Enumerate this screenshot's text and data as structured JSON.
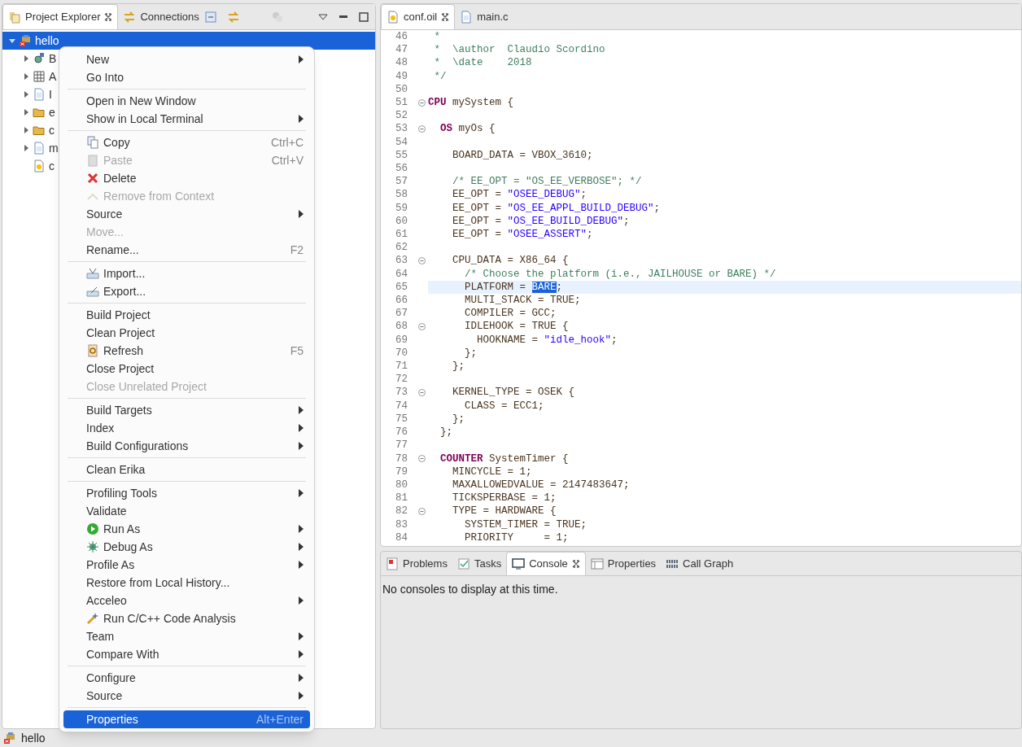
{
  "project_explorer": {
    "tabs": [
      {
        "label": "Project Explorer",
        "selected": true,
        "closable": true
      },
      {
        "label": "Connections",
        "selected": false,
        "closable": false
      }
    ],
    "tree": [
      {
        "label": "hello",
        "kind": "branch",
        "expanded": true,
        "selected": true,
        "children": [
          {
            "label": "B",
            "kind": "branch",
            "expanded": false,
            "selected": false
          },
          {
            "label": "A",
            "kind": "branch",
            "expanded": false,
            "selected": false
          },
          {
            "label": "I",
            "kind": "branch",
            "expanded": false,
            "selected": false
          },
          {
            "label": "e",
            "kind": "branch",
            "expanded": false,
            "selected": false
          },
          {
            "label": "c",
            "kind": "branch",
            "expanded": false,
            "selected": false
          },
          {
            "label": "m",
            "kind": "branch",
            "expanded": false,
            "selected": false
          },
          {
            "label": "c",
            "kind": "leaf",
            "selected": false
          }
        ]
      }
    ]
  },
  "editor": {
    "tabs": [
      {
        "label": "conf.oil",
        "selected": true,
        "closable": true
      },
      {
        "label": "main.c",
        "selected": false,
        "closable": false
      }
    ],
    "lines": [
      {
        "n": "46",
        "fold": false,
        "current": false,
        "tokens": [
          {
            "kind": "cm",
            "t": " *"
          }
        ]
      },
      {
        "n": "47",
        "fold": false,
        "current": false,
        "tokens": [
          {
            "kind": "cm",
            "t": " *  \\author  Claudio Scordino"
          }
        ]
      },
      {
        "n": "48",
        "fold": false,
        "current": false,
        "tokens": [
          {
            "kind": "cm",
            "t": " *  \\date    2018"
          }
        ]
      },
      {
        "n": "49",
        "fold": false,
        "current": false,
        "tokens": [
          {
            "kind": "cm",
            "t": " */"
          }
        ]
      },
      {
        "n": "50",
        "fold": false,
        "current": false
      },
      {
        "n": "51",
        "fold": true,
        "current": false,
        "tokens": [
          {
            "kind": "kw",
            "t": "CPU"
          },
          {
            "kind": "tx",
            "t": " mySystem {"
          }
        ]
      },
      {
        "n": "52",
        "fold": false,
        "current": false
      },
      {
        "n": "53",
        "fold": true,
        "current": false,
        "tokens": [
          {
            "kind": "kw",
            "t": "  OS"
          },
          {
            "kind": "tx",
            "t": " myOs {"
          }
        ]
      },
      {
        "n": "54",
        "fold": false,
        "current": false
      },
      {
        "n": "55",
        "fold": false,
        "current": false,
        "tokens": [
          {
            "kind": "tx",
            "t": "    BOARD_DATA = VBOX_3610;"
          }
        ]
      },
      {
        "n": "56",
        "fold": false,
        "current": false
      },
      {
        "n": "57",
        "fold": false,
        "current": false,
        "tokens": [
          {
            "kind": "cm",
            "t": "    /* EE_OPT = \"OS_EE_VERBOSE\"; */"
          }
        ]
      },
      {
        "n": "58",
        "fold": false,
        "current": false,
        "tokens": [
          {
            "kind": "tx",
            "t": "    EE_OPT = "
          },
          {
            "kind": "str",
            "t": "\"OSEE_DEBUG\""
          },
          {
            "kind": "tx",
            "t": ";"
          }
        ]
      },
      {
        "n": "59",
        "fold": false,
        "current": false,
        "tokens": [
          {
            "kind": "tx",
            "t": "    EE_OPT = "
          },
          {
            "kind": "str",
            "t": "\"OS_EE_APPL_BUILD_DEBUG\""
          },
          {
            "kind": "tx",
            "t": ";"
          }
        ]
      },
      {
        "n": "60",
        "fold": false,
        "current": false,
        "tokens": [
          {
            "kind": "tx",
            "t": "    EE_OPT = "
          },
          {
            "kind": "str",
            "t": "\"OS_EE_BUILD_DEBUG\""
          },
          {
            "kind": "tx",
            "t": ";"
          }
        ]
      },
      {
        "n": "61",
        "fold": false,
        "current": false,
        "tokens": [
          {
            "kind": "tx",
            "t": "    EE_OPT = "
          },
          {
            "kind": "str",
            "t": "\"OSEE_ASSERT\""
          },
          {
            "kind": "tx",
            "t": ";"
          }
        ]
      },
      {
        "n": "62",
        "fold": false,
        "current": false
      },
      {
        "n": "63",
        "fold": true,
        "current": false,
        "tokens": [
          {
            "kind": "tx",
            "t": "    CPU_DATA = X86_64 {"
          }
        ]
      },
      {
        "n": "64",
        "fold": false,
        "current": false,
        "tokens": [
          {
            "kind": "cm",
            "t": "      /* Choose the platform (i.e., JAILHOUSE or BARE) */"
          }
        ]
      },
      {
        "n": "65",
        "fold": false,
        "current": true,
        "tokens": [
          {
            "kind": "tx",
            "t": "      PLATFORM = "
          },
          {
            "kind": "sel",
            "t": "BARE"
          },
          {
            "kind": "tx",
            "t": ";"
          }
        ]
      },
      {
        "n": "66",
        "fold": false,
        "current": false,
        "tokens": [
          {
            "kind": "tx",
            "t": "      MULTI_STACK = TRUE;"
          }
        ]
      },
      {
        "n": "67",
        "fold": false,
        "current": false,
        "tokens": [
          {
            "kind": "tx",
            "t": "      COMPILER = GCC;"
          }
        ]
      },
      {
        "n": "68",
        "fold": true,
        "current": false,
        "tokens": [
          {
            "kind": "tx",
            "t": "      IDLEHOOK = TRUE {"
          }
        ]
      },
      {
        "n": "69",
        "fold": false,
        "current": false,
        "tokens": [
          {
            "kind": "tx",
            "t": "        HOOKNAME = "
          },
          {
            "kind": "str",
            "t": "\"idle_hook\""
          },
          {
            "kind": "tx",
            "t": ";"
          }
        ]
      },
      {
        "n": "70",
        "fold": false,
        "current": false,
        "tokens": [
          {
            "kind": "tx",
            "t": "      };"
          }
        ]
      },
      {
        "n": "71",
        "fold": false,
        "current": false,
        "tokens": [
          {
            "kind": "tx",
            "t": "    };"
          }
        ]
      },
      {
        "n": "72",
        "fold": false,
        "current": false
      },
      {
        "n": "73",
        "fold": true,
        "current": false,
        "tokens": [
          {
            "kind": "tx",
            "t": "    KERNEL_TYPE = OSEK {"
          }
        ]
      },
      {
        "n": "74",
        "fold": false,
        "current": false,
        "tokens": [
          {
            "kind": "tx",
            "t": "      CLASS = ECC1;"
          }
        ]
      },
      {
        "n": "75",
        "fold": false,
        "current": false,
        "tokens": [
          {
            "kind": "tx",
            "t": "    };"
          }
        ]
      },
      {
        "n": "76",
        "fold": false,
        "current": false,
        "tokens": [
          {
            "kind": "tx",
            "t": "  };"
          }
        ]
      },
      {
        "n": "77",
        "fold": false,
        "current": false
      },
      {
        "n": "78",
        "fold": true,
        "current": false,
        "tokens": [
          {
            "kind": "kw",
            "t": "  COUNTER"
          },
          {
            "kind": "tx",
            "t": " SystemTimer {"
          }
        ]
      },
      {
        "n": "79",
        "fold": false,
        "current": false,
        "tokens": [
          {
            "kind": "tx",
            "t": "    MINCYCLE = 1;"
          }
        ]
      },
      {
        "n": "80",
        "fold": false,
        "current": false,
        "tokens": [
          {
            "kind": "tx",
            "t": "    MAXALLOWEDVALUE = 2147483647;"
          }
        ]
      },
      {
        "n": "81",
        "fold": false,
        "current": false,
        "tokens": [
          {
            "kind": "tx",
            "t": "    TICKSPERBASE = 1;"
          }
        ]
      },
      {
        "n": "82",
        "fold": true,
        "current": false,
        "tokens": [
          {
            "kind": "tx",
            "t": "    TYPE = HARDWARE {"
          }
        ]
      },
      {
        "n": "83",
        "fold": false,
        "current": false,
        "tokens": [
          {
            "kind": "tx",
            "t": "      SYSTEM_TIMER = TRUE;"
          }
        ]
      },
      {
        "n": "84",
        "fold": false,
        "current": false,
        "tokens": [
          {
            "kind": "tx",
            "t": "      PRIORITY     = 1;"
          }
        ]
      }
    ]
  },
  "bottom_panel": {
    "tabs": [
      {
        "label": "Problems",
        "selected": false,
        "closable": false
      },
      {
        "label": "Tasks",
        "selected": false,
        "closable": false
      },
      {
        "label": "Console",
        "selected": true,
        "closable": true
      },
      {
        "label": "Properties",
        "selected": false,
        "closable": false
      },
      {
        "label": "Call Graph",
        "selected": false,
        "closable": false
      }
    ],
    "message": "No consoles to display at this time."
  },
  "context_menu": {
    "items": [
      {
        "kind": "item",
        "label": "New",
        "submenu": true,
        "disabled": false,
        "selected": false
      },
      {
        "kind": "item",
        "label": "Go Into",
        "submenu": false,
        "disabled": false,
        "selected": false
      },
      {
        "kind": "separator"
      },
      {
        "kind": "item",
        "label": "Open in New Window",
        "submenu": false,
        "disabled": false,
        "selected": false
      },
      {
        "kind": "item",
        "label": "Show in Local Terminal",
        "submenu": true,
        "disabled": false,
        "selected": false
      },
      {
        "kind": "separator"
      },
      {
        "kind": "item",
        "label": "Copy",
        "shortcut": "Ctrl+C",
        "submenu": false,
        "disabled": false,
        "selected": false
      },
      {
        "kind": "item",
        "label": "Paste",
        "shortcut": "Ctrl+V",
        "submenu": false,
        "disabled": true,
        "selected": false
      },
      {
        "kind": "item",
        "label": "Delete",
        "submenu": false,
        "disabled": false,
        "selected": false
      },
      {
        "kind": "item",
        "label": "Remove from Context",
        "submenu": false,
        "disabled": true,
        "selected": false
      },
      {
        "kind": "item",
        "label": "Source",
        "submenu": true,
        "disabled": false,
        "selected": false
      },
      {
        "kind": "item",
        "label": "Move...",
        "submenu": false,
        "disabled": true,
        "selected": false
      },
      {
        "kind": "item",
        "label": "Rename...",
        "shortcut": "F2",
        "submenu": false,
        "disabled": false,
        "selected": false
      },
      {
        "kind": "separator"
      },
      {
        "kind": "item",
        "label": "Import...",
        "submenu": false,
        "disabled": false,
        "selected": false
      },
      {
        "kind": "item",
        "label": "Export...",
        "submenu": false,
        "disabled": false,
        "selected": false
      },
      {
        "kind": "separator"
      },
      {
        "kind": "item",
        "label": "Build Project",
        "submenu": false,
        "disabled": false,
        "selected": false
      },
      {
        "kind": "item",
        "label": "Clean Project",
        "submenu": false,
        "disabled": false,
        "selected": false
      },
      {
        "kind": "item",
        "label": "Refresh",
        "shortcut": "F5",
        "submenu": false,
        "disabled": false,
        "selected": false
      },
      {
        "kind": "item",
        "label": "Close Project",
        "submenu": false,
        "disabled": false,
        "selected": false
      },
      {
        "kind": "item",
        "label": "Close Unrelated Project",
        "submenu": false,
        "disabled": true,
        "selected": false
      },
      {
        "kind": "separator"
      },
      {
        "kind": "item",
        "label": "Build Targets",
        "submenu": true,
        "disabled": false,
        "selected": false
      },
      {
        "kind": "item",
        "label": "Index",
        "submenu": true,
        "disabled": false,
        "selected": false
      },
      {
        "kind": "item",
        "label": "Build Configurations",
        "submenu": true,
        "disabled": false,
        "selected": false
      },
      {
        "kind": "separator"
      },
      {
        "kind": "item",
        "label": "Clean Erika",
        "submenu": false,
        "disabled": false,
        "selected": false
      },
      {
        "kind": "separator"
      },
      {
        "kind": "item",
        "label": "Profiling Tools",
        "submenu": true,
        "disabled": false,
        "selected": false
      },
      {
        "kind": "item",
        "label": "Validate",
        "submenu": false,
        "disabled": false,
        "selected": false
      },
      {
        "kind": "item",
        "label": "Run As",
        "submenu": true,
        "disabled": false,
        "selected": false
      },
      {
        "kind": "item",
        "label": "Debug As",
        "submenu": true,
        "disabled": false,
        "selected": false
      },
      {
        "kind": "item",
        "label": "Profile As",
        "submenu": true,
        "disabled": false,
        "selected": false
      },
      {
        "kind": "item",
        "label": "Restore from Local History...",
        "submenu": false,
        "disabled": false,
        "selected": false
      },
      {
        "kind": "item",
        "label": "Acceleo",
        "submenu": true,
        "disabled": false,
        "selected": false
      },
      {
        "kind": "item",
        "label": "Run C/C++ Code Analysis",
        "submenu": false,
        "disabled": false,
        "selected": false
      },
      {
        "kind": "item",
        "label": "Team",
        "submenu": true,
        "disabled": false,
        "selected": false
      },
      {
        "kind": "item",
        "label": "Compare With",
        "submenu": true,
        "disabled": false,
        "selected": false
      },
      {
        "kind": "separator"
      },
      {
        "kind": "item",
        "label": "Configure",
        "submenu": true,
        "disabled": false,
        "selected": false
      },
      {
        "kind": "item",
        "label": "Source",
        "submenu": true,
        "disabled": false,
        "selected": false
      },
      {
        "kind": "separator"
      },
      {
        "kind": "item",
        "label": "Properties",
        "shortcut": "Alt+Enter",
        "submenu": false,
        "disabled": false,
        "selected": true
      }
    ]
  },
  "status_bar": {
    "text": "hello"
  }
}
